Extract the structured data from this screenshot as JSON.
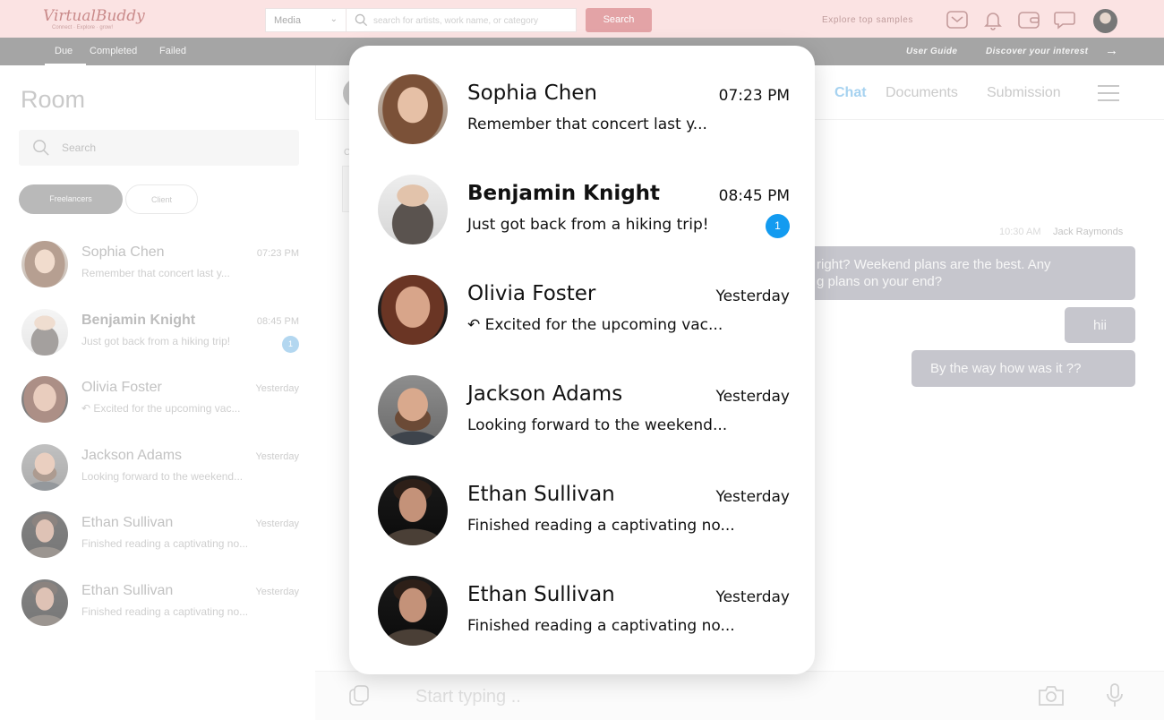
{
  "brand": {
    "name": "VirtualBuddy",
    "tagline": "Connect · Explore · grow!"
  },
  "topbar": {
    "media_select": "Media",
    "search_placeholder": "search for artists, work name, or category",
    "search_button": "Search",
    "explore_link": "Explore top samples",
    "icons": [
      "mail-icon",
      "bell-icon",
      "wallet-icon",
      "chat-bubble-icon"
    ]
  },
  "subnav": {
    "tabs": [
      "Due",
      "Completed",
      "Failed"
    ],
    "active_tab": "Due",
    "user_guide": "User Guide",
    "discover": "Discover your interest"
  },
  "room": {
    "title": "Room",
    "search_placeholder": "Search",
    "filters": [
      "Freelancers",
      "Client"
    ],
    "active_filter": "Freelancers",
    "conversations": [
      {
        "name": "Sophia Chen",
        "time": "07:23 PM",
        "preview": "Remember that concert last y...",
        "unread": "",
        "bold": false,
        "reply": false
      },
      {
        "name": "Benjamin Knight",
        "time": "08:45 PM",
        "preview": "Just got back from a hiking trip!",
        "unread": "1",
        "bold": true,
        "reply": false
      },
      {
        "name": "Olivia Foster",
        "time": "Yesterday",
        "preview": "Excited for the upcoming vac...",
        "unread": "",
        "bold": false,
        "reply": true
      },
      {
        "name": "Jackson Adams",
        "time": "Yesterday",
        "preview": "Looking forward to the weekend...",
        "unread": "",
        "bold": false,
        "reply": false
      },
      {
        "name": "Ethan Sullivan",
        "time": "Yesterday",
        "preview": "Finished reading a captivating no...",
        "unread": "",
        "bold": false,
        "reply": false
      },
      {
        "name": "Ethan Sullivan",
        "time": "Yesterday",
        "preview": "Finished reading a captivating no...",
        "unread": "",
        "bold": false,
        "reply": false
      }
    ]
  },
  "chat": {
    "tabs": [
      "Chat",
      "Documents",
      "Submission"
    ],
    "active_tab": "Chat",
    "stray_label": "C",
    "message_time": "10:30 AM",
    "message_sender": "Jack Raymonds",
    "messages": [
      {
        "text_line1": "right? Weekend plans are the best. Any",
        "text_line2": "g plans on your end?"
      },
      {
        "text_line1": "hii",
        "text_line2": ""
      },
      {
        "text_line1": "By the way how was it ??",
        "text_line2": ""
      }
    ],
    "composer_placeholder": "Start typing ..",
    "colors": {
      "accent": "#139bf0",
      "bubble": "#c6c6cd"
    }
  },
  "popup": {
    "conversations": [
      {
        "name": "Sophia Chen",
        "time": "07:23 PM",
        "preview": "Remember that concert last y...",
        "unread": "",
        "bold": false,
        "reply": false
      },
      {
        "name": "Benjamin Knight",
        "time": "08:45 PM",
        "preview": "Just got back from a hiking trip!",
        "unread": "1",
        "bold": true,
        "reply": false
      },
      {
        "name": "Olivia Foster",
        "time": "Yesterday",
        "preview": "Excited for the upcoming vac...",
        "unread": "",
        "bold": false,
        "reply": true
      },
      {
        "name": "Jackson Adams",
        "time": "Yesterday",
        "preview": "Looking forward to the weekend...",
        "unread": "",
        "bold": false,
        "reply": false
      },
      {
        "name": "Ethan Sullivan",
        "time": "Yesterday",
        "preview": "Finished reading a captivating no...",
        "unread": "",
        "bold": false,
        "reply": false
      },
      {
        "name": "Ethan Sullivan",
        "time": "Yesterday",
        "preview": "Finished reading a captivating no...",
        "unread": "",
        "bold": false,
        "reply": false
      }
    ]
  }
}
